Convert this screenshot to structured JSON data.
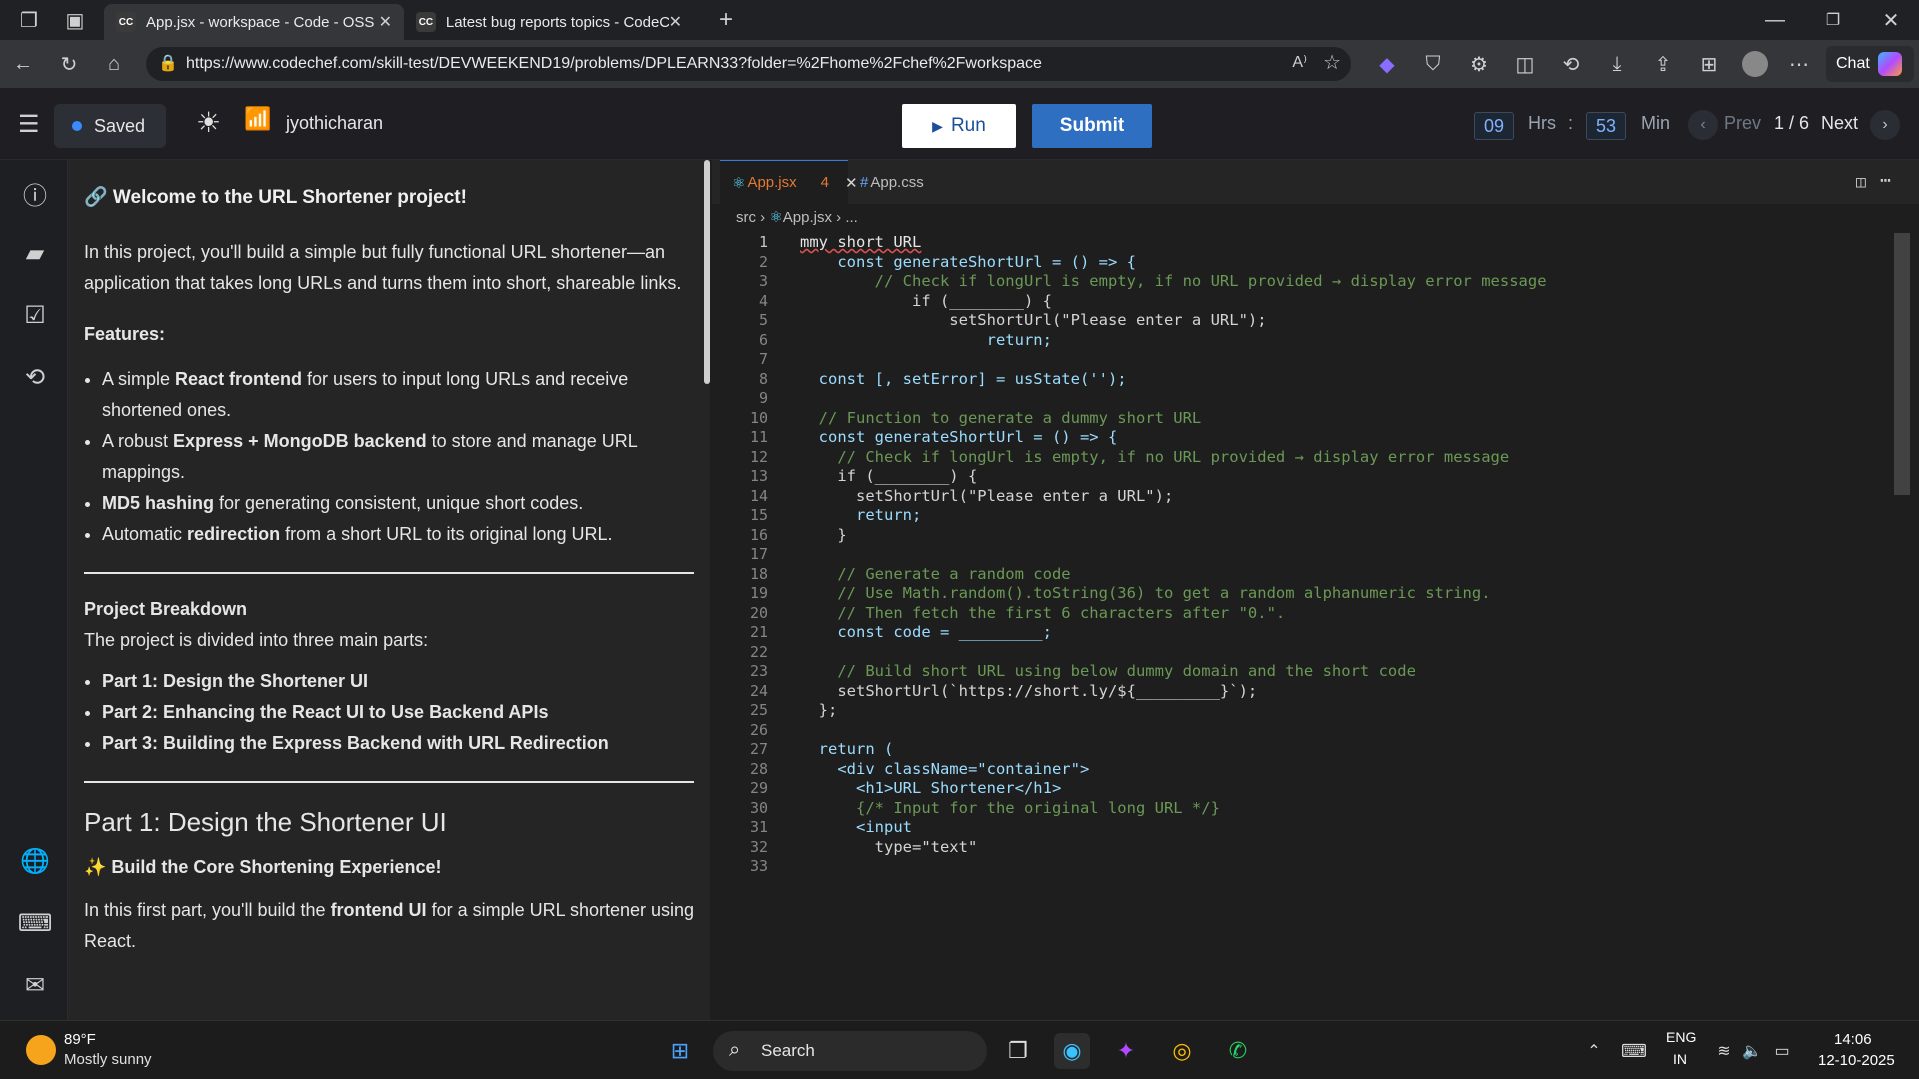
{
  "browser": {
    "tabs": [
      {
        "favicon": "CC",
        "title": "App.jsx - workspace - Code - OSS",
        "active": true
      },
      {
        "favicon": "CC",
        "title": "Latest bug reports topics - CodeC",
        "active": false
      }
    ],
    "url": "https://www.codechef.com/skill-test/DEVWEEKEND19/problems/DPLEARN33?folder=%2Fhome%2Fchef%2Fworkspace",
    "chat_label": "Chat"
  },
  "header": {
    "saved_label": "Saved",
    "username": "jyothicharan",
    "run_label": "Run",
    "submit_label": "Submit",
    "hours": "09",
    "hrs_label": "Hrs",
    "sep": ":",
    "minutes": "53",
    "min_label": "Min",
    "prev_label": "Prev",
    "page": "1 / 6",
    "next_label": "Next"
  },
  "problem": {
    "title": "🔗 Welcome to the URL Shortener project!",
    "intro": "In this project, you'll build a simple but fully functional URL shortener—an application that takes long URLs and turns them into short, shareable links.",
    "features_heading": "Features:",
    "features": [
      {
        "pre": "A simple ",
        "bold": "React frontend",
        "post": " for users to input long URLs and receive shortened ones."
      },
      {
        "pre": "A robust ",
        "bold": "Express + MongoDB backend",
        "post": " to store and manage URL mappings."
      },
      {
        "pre": "",
        "bold": "MD5 hashing",
        "post": " for generating consistent, unique short codes."
      },
      {
        "pre": "Automatic ",
        "bold": "redirection",
        "post": " from a short URL to its original long URL."
      }
    ],
    "breakdown_heading": "Project Breakdown",
    "breakdown_intro": "The project is divided into three main parts:",
    "parts": [
      "Part 1: Design the Shortener UI",
      "Part 2: Enhancing the React UI to Use Backend APIs",
      "Part 3: Building the Express Backend with URL Redirection"
    ],
    "part1_title": "Part 1: Design the Shortener UI",
    "part1_sub": "✨ Build the Core Shortening Experience!",
    "part1_text_pre": "In this first part, you'll build the ",
    "part1_text_bold": "frontend UI",
    "part1_text_post": " for a simple URL shortener using React."
  },
  "editor": {
    "tabs": [
      {
        "label": "App.jsx",
        "badge": "4",
        "active": true
      },
      {
        "label": "App.css",
        "badge": "",
        "active": false
      }
    ],
    "breadcrumb": [
      "src",
      "App.jsx",
      "..."
    ],
    "lines": [
      "mmy short URL",
      "    const generateShortUrl = () => {",
      "        // Check if longUrl is empty, if no URL provided → display error message",
      "            if (________) {",
      "                setShortUrl(\"Please enter a URL\");",
      "                    return;",
      "",
      "  const [, setError] = usState('');",
      "",
      "  // Function to generate a dummy short URL",
      "  const generateShortUrl = () => {",
      "    // Check if longUrl is empty, if no URL provided → display error message",
      "    if (________) {",
      "      setShortUrl(\"Please enter a URL\");",
      "      return;",
      "    }",
      "",
      "    // Generate a random code",
      "    // Use Math.random().toString(36) to get a random alphanumeric string.",
      "    // Then fetch the first 6 characters after \"0.\".",
      "    const code = _________;",
      "",
      "    // Build short URL using below dummy domain and the short code",
      "    setShortUrl(`https://short.ly/${_________}`);",
      "  };",
      "",
      "  return (",
      "    <div className=\"container\">",
      "      <h1>URL Shortener</h1>",
      "      {/* Input for the original long URL */}",
      "      <input",
      "        type=\"text\"",
      ""
    ]
  },
  "taskbar": {
    "temp": "89°F",
    "weather": "Mostly sunny",
    "search_label": "Search",
    "lang": "ENG",
    "region": "IN",
    "time": "14:06",
    "date": "12-10-2025"
  }
}
